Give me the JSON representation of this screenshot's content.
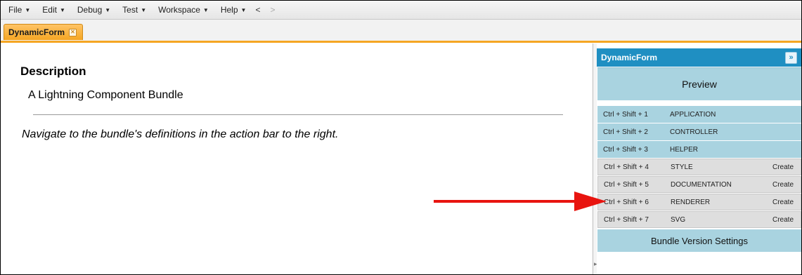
{
  "menubar": {
    "items": [
      {
        "label": "File",
        "name": "menu-file"
      },
      {
        "label": "Edit",
        "name": "menu-edit"
      },
      {
        "label": "Debug",
        "name": "menu-debug"
      },
      {
        "label": "Test",
        "name": "menu-test"
      },
      {
        "label": "Workspace",
        "name": "menu-workspace"
      },
      {
        "label": "Help",
        "name": "menu-help"
      }
    ],
    "back": "<",
    "forward": ">"
  },
  "tab": {
    "label": "DynamicForm"
  },
  "main": {
    "heading": "Description",
    "subtitle": "A Lightning Component Bundle",
    "hint": "Navigate to the bundle's definitions in the action bar to the right."
  },
  "panel": {
    "title": "DynamicForm",
    "collapse_glyph": "»",
    "preview_label": "Preview",
    "rows": [
      {
        "shortcut": "Ctrl + Shift + 1",
        "label": "APPLICATION",
        "action": "",
        "exists": true
      },
      {
        "shortcut": "Ctrl + Shift + 2",
        "label": "CONTROLLER",
        "action": "",
        "exists": true
      },
      {
        "shortcut": "Ctrl + Shift + 3",
        "label": "HELPER",
        "action": "",
        "exists": true
      },
      {
        "shortcut": "Ctrl + Shift + 4",
        "label": "STYLE",
        "action": "Create",
        "exists": false
      },
      {
        "shortcut": "Ctrl + Shift + 5",
        "label": "DOCUMENTATION",
        "action": "Create",
        "exists": false
      },
      {
        "shortcut": "Ctrl + Shift + 6",
        "label": "RENDERER",
        "action": "Create",
        "exists": false
      },
      {
        "shortcut": "Ctrl + Shift + 7",
        "label": "SVG",
        "action": "Create",
        "exists": false
      }
    ],
    "bundle_settings_label": "Bundle Version Settings"
  },
  "colors": {
    "tab_accent": "#f5a623",
    "panel_header": "#1f8fc2",
    "panel_button": "#a9d3e0",
    "annotation_arrow": "#e8140f"
  }
}
